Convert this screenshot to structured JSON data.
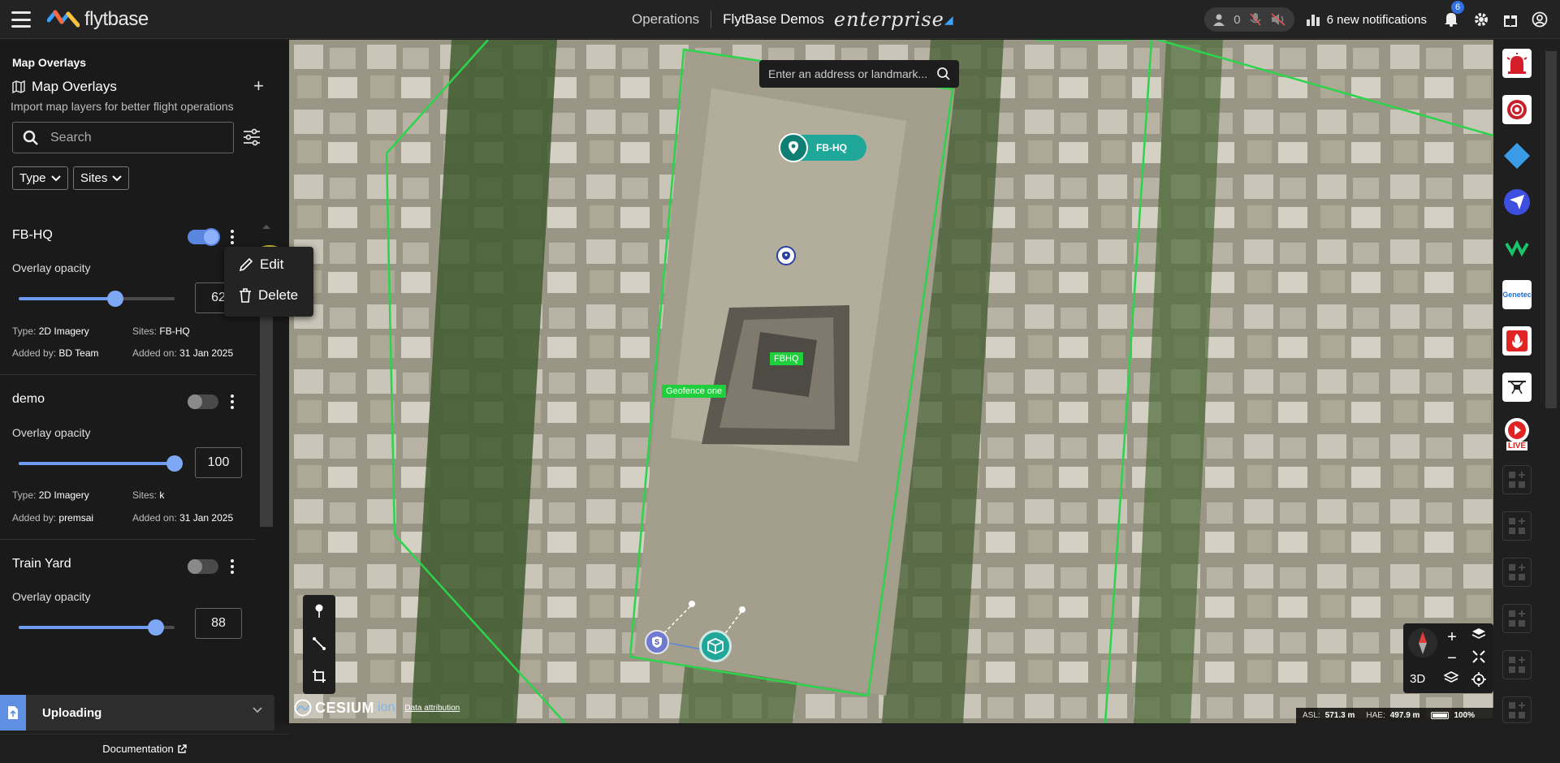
{
  "topbar": {
    "brand": "flytbase",
    "nav_operations": "Operations",
    "org_name": "FlytBase Demos",
    "edition": "enterprise",
    "user_count": "0",
    "notifications_label": "6 new notifications",
    "notification_badge": "6"
  },
  "panel": {
    "section_title": "Map Overlays",
    "heading": "Map Overlays",
    "subtitle": "Import map layers for better flight operations",
    "search_placeholder": "Search",
    "filter_type": "Type",
    "filter_sites": "Sites",
    "layers": [
      {
        "name": "FB-HQ",
        "enabled": true,
        "opacity_label": "Overlay opacity",
        "opacity": 62,
        "opacity_text": "62",
        "type_label": "Type:",
        "type": "2D Imagery",
        "sites_label": "Sites:",
        "sites": "FB-HQ",
        "added_by_label": "Added by:",
        "added_by": "BD Team",
        "added_on_label": "Added on:",
        "added_on": "31 Jan 2025"
      },
      {
        "name": "demo",
        "enabled": false,
        "opacity_label": "Overlay opacity",
        "opacity": 100,
        "opacity_text": "100",
        "type_label": "Type:",
        "type": "2D Imagery",
        "sites_label": "Sites:",
        "sites": "k",
        "added_by_label": "Added by:",
        "added_by": "premsai",
        "added_on_label": "Added on:",
        "added_on": "31 Jan 2025"
      },
      {
        "name": "Train Yard",
        "enabled": false,
        "opacity_label": "Overlay opacity",
        "opacity": 88,
        "opacity_text": "88"
      }
    ],
    "context_menu": {
      "edit": "Edit",
      "delete": "Delete"
    },
    "uploading_label": "Uploading",
    "documentation_label": "Documentation"
  },
  "map": {
    "address_placeholder": "Enter an address or landmark...",
    "site_pin_label": "FB-HQ",
    "overlay_label": "FBHQ",
    "geofence_label": "Geofence one",
    "dock_marker_label": "S",
    "view_mode": "3D",
    "cesium_brand": "CESIUM",
    "cesium_ion": "ion",
    "data_attribution": "Data attribution",
    "asl_label": "ASL:",
    "asl_value": "571.3 m",
    "hae_label": "HAE:",
    "hae_value": "497.9 m",
    "zoom_pct": "100%",
    "battery_level": 1.0
  },
  "rail": {
    "items": [
      "alarm-icon",
      "shield-app-icon",
      "diamond-app-icon",
      "send-app-icon",
      "va-app-icon",
      "genetec-app-icon",
      "fire-alert-icon",
      "drone-app-icon",
      "live-app-icon",
      "add-app-slot",
      "add-app-slot",
      "add-app-slot",
      "add-app-slot",
      "add-app-slot",
      "add-app-slot"
    ],
    "genetec_text": "Genetec",
    "live_text": "LIVE"
  },
  "colors": {
    "accent": "#5a86e0",
    "geofence": "#22d04a",
    "site_pin": "#1fa79a"
  }
}
